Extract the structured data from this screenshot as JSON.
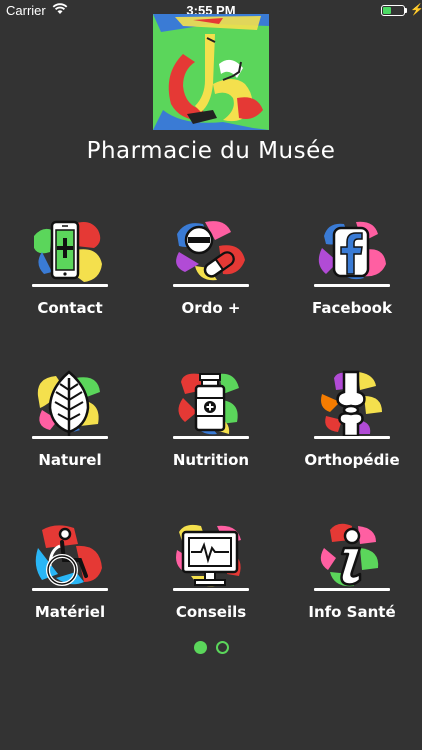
{
  "status_bar": {
    "carrier": "Carrier",
    "time": "3:55 PM",
    "battery_level": 0.4
  },
  "app": {
    "title": "Pharmacie du Musée"
  },
  "menu": [
    {
      "label": "Contact",
      "icon": "phone-icon"
    },
    {
      "label": "Ordo +",
      "icon": "pills-icon"
    },
    {
      "label": "Facebook",
      "icon": "facebook-icon"
    },
    {
      "label": "Naturel",
      "icon": "leaf-icon"
    },
    {
      "label": "Nutrition",
      "icon": "supplement-bottle-icon"
    },
    {
      "label": "Orthopédie",
      "icon": "knee-joint-icon"
    },
    {
      "label": "Matériel",
      "icon": "wheelchair-icon"
    },
    {
      "label": "Conseils",
      "icon": "monitor-heartbeat-icon"
    },
    {
      "label": "Info Santé",
      "icon": "info-icon"
    }
  ],
  "pager": {
    "pages": 2,
    "current": 1
  },
  "colors": {
    "background": "#333333",
    "accent": "#5bd65b"
  }
}
